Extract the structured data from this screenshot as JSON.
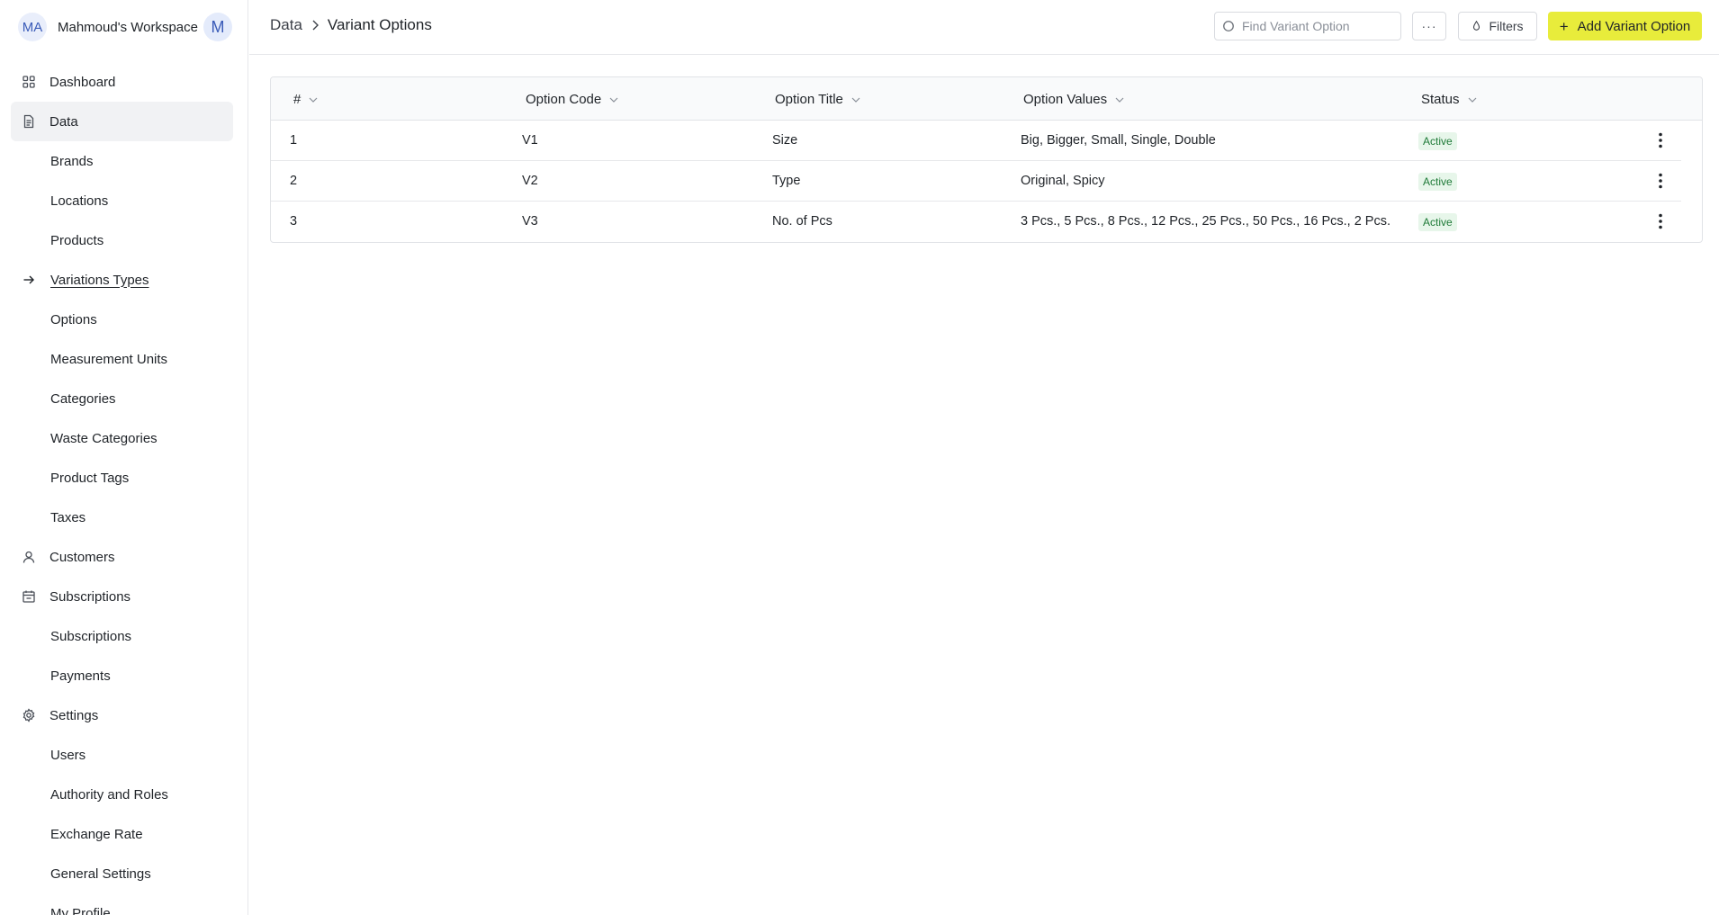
{
  "workspace": {
    "initials": "MA",
    "name": "Mahmoud's Workspace",
    "user_initial": "M"
  },
  "sidebar": {
    "items": [
      {
        "label": "Dashboard",
        "level": "top",
        "icon": "grid-icon"
      },
      {
        "label": "Data",
        "level": "top",
        "icon": "document-icon",
        "active": true
      },
      {
        "label": "Brands",
        "level": "sub"
      },
      {
        "label": "Locations",
        "level": "sub"
      },
      {
        "label": "Products",
        "level": "sub"
      },
      {
        "label": "Variations Types",
        "level": "sub",
        "current": true,
        "icon": "arrow-right-icon"
      },
      {
        "label": "Options",
        "level": "sub"
      },
      {
        "label": "Measurement Units",
        "level": "sub"
      },
      {
        "label": "Categories",
        "level": "sub"
      },
      {
        "label": "Waste Categories",
        "level": "sub"
      },
      {
        "label": "Product Tags",
        "level": "sub"
      },
      {
        "label": "Taxes",
        "level": "sub"
      },
      {
        "label": "Customers",
        "level": "top",
        "icon": "user-icon"
      },
      {
        "label": "Subscriptions",
        "level": "top",
        "icon": "calendar-icon"
      },
      {
        "label": "Subscriptions",
        "level": "sub"
      },
      {
        "label": "Payments",
        "level": "sub"
      },
      {
        "label": "Settings",
        "level": "top",
        "icon": "gear-icon"
      },
      {
        "label": "Users",
        "level": "sub"
      },
      {
        "label": "Authority and Roles",
        "level": "sub"
      },
      {
        "label": "Exchange Rate",
        "level": "sub"
      },
      {
        "label": "General Settings",
        "level": "sub"
      },
      {
        "label": "My Profile",
        "level": "sub"
      }
    ]
  },
  "header": {
    "breadcrumb": [
      "Data",
      "Variant Options"
    ],
    "search_placeholder": "Find Variant Option",
    "more_label": "···",
    "filters_label": "Filters",
    "add_label": "Add Variant Option",
    "add_icon": "+",
    "accent_color": "#e8ec3b"
  },
  "table": {
    "columns": [
      "#",
      "Option Code",
      "Option Title",
      "Option Values",
      "Status"
    ],
    "rows": [
      {
        "num": "1",
        "code": "V1",
        "title": "Size",
        "values": "Big, Bigger, Small, Single, Double",
        "status": "Active"
      },
      {
        "num": "2",
        "code": "V2",
        "title": "Type",
        "values": "Original, Spicy",
        "status": "Active"
      },
      {
        "num": "3",
        "code": "V3",
        "title": "No. of Pcs",
        "values": "3 Pcs., 5 Pcs., 8 Pcs., 12 Pcs., 25 Pcs., 50 Pcs., 16 Pcs., 2 Pcs.",
        "status": "Active"
      }
    ]
  }
}
